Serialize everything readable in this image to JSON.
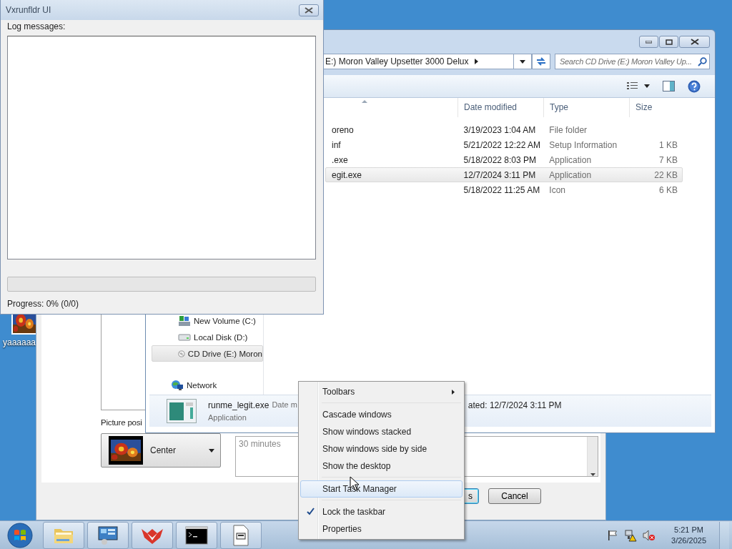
{
  "desktop": {
    "icons": [
      {
        "label": "yaaaaaa"
      }
    ]
  },
  "settings_window": {
    "picture_position": {
      "label": "Picture posi",
      "value": "Center"
    },
    "wait_field": {
      "value": "30 minutes"
    },
    "buttons": [
      {
        "label": "s",
        "kind": "default"
      },
      {
        "label": "Cancel",
        "kind": "normal"
      }
    ]
  },
  "explorer": {
    "address": "E:) Moron Valley Upsetter 3000 Delux",
    "search": {
      "placeholder": "Search CD Drive (E:) Moron Valley Up..."
    },
    "columns": [
      "Date modified",
      "Type",
      "Size"
    ],
    "rows": [
      {
        "name": "oreno",
        "date": "3/19/2023 1:04 AM",
        "type": "File folder",
        "selected": false
      },
      {
        "name": "inf",
        "date": "5/21/2022 12:22 AM",
        "type": "Setup Information",
        "size": "1 KB",
        "selected": false
      },
      {
        "name": ".exe",
        "date": "5/18/2022 8:03 PM",
        "type": "Application",
        "size": "7 KB",
        "selected": false
      },
      {
        "name": "egit.exe",
        "date": "12/7/2024 3:11 PM",
        "type": "Application",
        "size": "22 KB",
        "selected": true
      },
      {
        "date": "5/18/2022 11:25 AM",
        "type": "Icon",
        "size": "6 KB",
        "selected": false
      }
    ],
    "nav": [
      {
        "label": "New Volume (C:)",
        "kind": "volume",
        "selected": false
      },
      {
        "label": "Local Disk (D:)",
        "kind": "disk",
        "selected": false
      },
      {
        "label": "CD Drive (E:) Moron",
        "kind": "cd",
        "selected": true
      },
      {
        "label": "Network",
        "kind": "network",
        "selected": false
      }
    ],
    "details": {
      "name": "runme_legit.exe",
      "date_label": "Date m",
      "type": "Application",
      "created": "ated: 12/7/2024 3:11 PM"
    }
  },
  "log_window": {
    "title": "Vxrunfldr UI",
    "log_label": "Log messages:",
    "progress": {
      "level": 0
    },
    "progress_text": "Progress: 0% (0/0)"
  },
  "context_menu": {
    "groups": [
      [
        {
          "label": "Toolbars",
          "kind": "submenu",
          "selected": false,
          "checked": false
        }
      ],
      [
        {
          "label": "Cascade windows",
          "kind": "command",
          "selected": false,
          "checked": false
        },
        {
          "label": "Show windows stacked",
          "kind": "command",
          "selected": false,
          "checked": false
        },
        {
          "label": "Show windows side by side",
          "kind": "command",
          "selected": false,
          "checked": false
        },
        {
          "label": "Show the desktop",
          "kind": "command",
          "selected": false,
          "checked": false
        }
      ],
      [
        {
          "label": "Start Task Manager",
          "kind": "command",
          "selected": true,
          "checked": false
        }
      ],
      [
        {
          "label": "Lock the taskbar",
          "kind": "command",
          "selected": false,
          "checked": true
        },
        {
          "label": "Properties",
          "kind": "command",
          "selected": false,
          "checked": false
        }
      ]
    ]
  },
  "taskbar": {
    "buttons": [
      {
        "kind": "folder"
      },
      {
        "kind": "control-panel"
      },
      {
        "kind": "fox"
      },
      {
        "kind": "console"
      },
      {
        "kind": "document"
      }
    ],
    "tray": [
      {
        "kind": "flag"
      },
      {
        "kind": "network"
      },
      {
        "kind": "speaker"
      }
    ],
    "clock": {
      "time": "5:21 PM",
      "date": "3/26/2025"
    }
  }
}
